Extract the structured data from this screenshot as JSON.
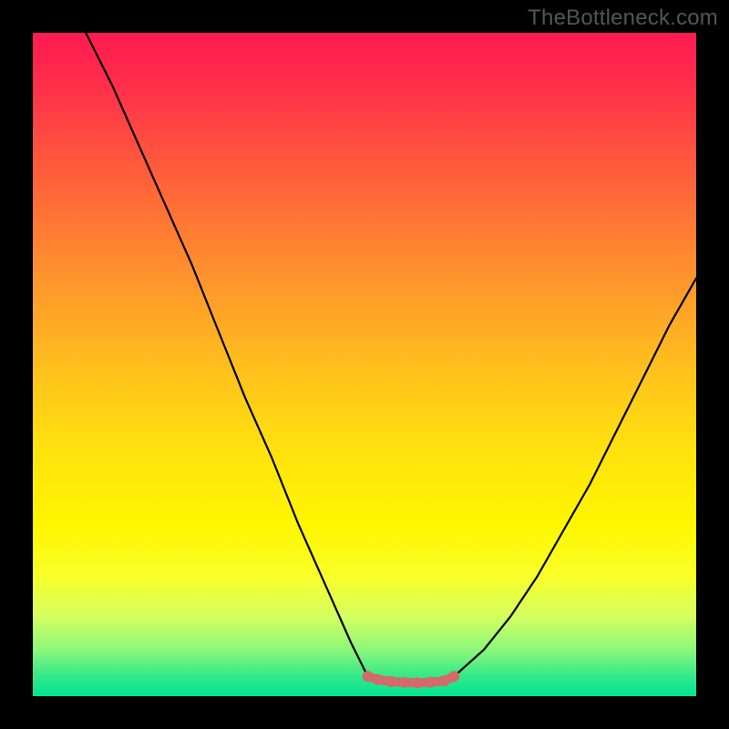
{
  "watermark": "TheBottleneck.com",
  "chart_data": {
    "type": "line",
    "title": "",
    "xlabel": "",
    "ylabel": "",
    "xlim": [
      0,
      100
    ],
    "ylim": [
      0,
      100
    ],
    "series": [
      {
        "name": "left-curve",
        "x": [
          8,
          12,
          16,
          20,
          24,
          28,
          32,
          36,
          40,
          44,
          48,
          50.5
        ],
        "y": [
          100,
          92,
          83,
          74,
          65,
          55,
          45,
          36,
          26,
          17,
          8,
          3
        ]
      },
      {
        "name": "floor",
        "x": [
          50.5,
          54,
          58,
          62,
          63.5
        ],
        "y": [
          3,
          2.2,
          2.0,
          2.3,
          3
        ]
      },
      {
        "name": "right-curve",
        "x": [
          63.5,
          68,
          72,
          76,
          80,
          84,
          88,
          92,
          96,
          100
        ],
        "y": [
          3,
          7,
          12,
          18,
          25,
          32,
          40,
          48,
          56,
          63
        ]
      }
    ],
    "highlight": {
      "name": "floor-highlight",
      "color": "#d46a6a",
      "x": [
        50.5,
        52,
        54,
        56,
        58,
        60,
        62,
        63.5
      ],
      "y": [
        3,
        2.5,
        2.2,
        2.1,
        2.0,
        2.1,
        2.3,
        3
      ]
    },
    "colors": {
      "curve": "#000000",
      "highlight": "#d46a6a",
      "background_top": "#ff1a52",
      "background_bottom": "#00e492",
      "frame": "#000000"
    }
  }
}
